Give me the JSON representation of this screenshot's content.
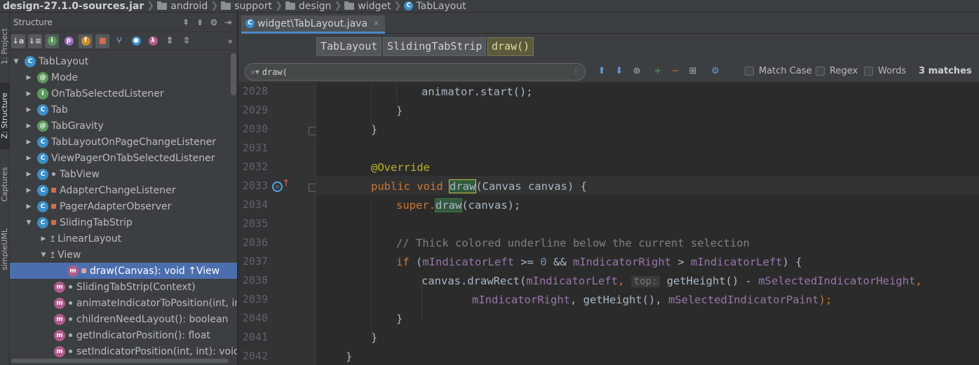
{
  "breadcrumb": [
    "design-27.1.0-sources.jar",
    "android",
    "support",
    "design",
    "widget",
    "TabLayout"
  ],
  "tool_stripe": {
    "project": "1: Project",
    "structure": "Z: Structure",
    "captures": "Captures",
    "simpleuml": "simpleUML"
  },
  "structure": {
    "title": "Structure",
    "items": [
      {
        "label": "TabLayout",
        "kind": "class",
        "expanded": true
      },
      {
        "label": "Mode",
        "kind": "interface"
      },
      {
        "label": "OnTabSelectedListener",
        "kind": "interface"
      },
      {
        "label": "Tab",
        "kind": "class"
      },
      {
        "label": "TabGravity",
        "kind": "interface"
      },
      {
        "label": "TabLayoutOnPageChangeListener",
        "kind": "class"
      },
      {
        "label": "ViewPagerOnTabSelectedListener",
        "kind": "class"
      },
      {
        "label": "TabView",
        "kind": "class"
      },
      {
        "label": "AdapterChangeListener",
        "kind": "class"
      },
      {
        "label": "PagerAdapterObserver",
        "kind": "class"
      },
      {
        "label": "SlidingTabStrip",
        "kind": "class",
        "expanded": true
      },
      {
        "label": "LinearLayout",
        "kind": "super"
      },
      {
        "label": "View",
        "kind": "super",
        "expanded": true
      },
      {
        "label": "draw(Canvas): void ↑View",
        "kind": "method",
        "selected": true
      },
      {
        "label": "SlidingTabStrip(Context)",
        "kind": "method"
      },
      {
        "label": "animateIndicatorToPosition(int, in",
        "kind": "method"
      },
      {
        "label": "childrenNeedLayout(): boolean",
        "kind": "method"
      },
      {
        "label": "getIndicatorPosition(): float",
        "kind": "method"
      },
      {
        "label": "setIndicatorPosition(int, int): void",
        "kind": "method"
      }
    ]
  },
  "editor": {
    "tab_label": "widget\\TabLayout.java",
    "chips": [
      "TabLayout",
      "SlidingTabStrip",
      "draw()"
    ],
    "find": {
      "query": "draw(",
      "match_case": "Match Case",
      "regex": "Regex",
      "words": "Words",
      "matches": "3 matches"
    },
    "line_numbers": [
      "2028",
      "2029",
      "2030",
      "2031",
      "2032",
      "2033",
      "2034",
      "2035",
      "2036",
      "2037",
      "2038",
      "2039",
      "2040",
      "2041",
      "2042"
    ],
    "code": {
      "l2028": "animator.start();",
      "l2029": "}",
      "l2030": "}",
      "l2032": "@Override",
      "l2033_kw": "public void ",
      "l2033_name": "draw",
      "l2033_rest": "(Canvas canvas) {",
      "l2034_super": "super.",
      "l2034_call": "draw",
      "l2034_rest": "(canvas);",
      "l2036": "// Thick colored underline below the current selection",
      "l2037_if": "if ",
      "l2037_a": "(",
      "l2037_f1": "mIndicatorLeft",
      "l2037_b": " >= ",
      "l2037_n": "0",
      "l2037_c": " && ",
      "l2037_f2": "mIndicatorRight",
      "l2037_d": " > ",
      "l2037_f3": "mIndicatorLeft",
      "l2037_e": ") {",
      "l2038_a": "canvas.drawRect(",
      "l2038_f1": "mIndicatorLeft",
      "l2038_b": ", ",
      "l2038_hint": "top:",
      "l2038_c": " getHeight() - ",
      "l2038_f2": "mSelectedIndicatorHeight",
      "l2038_d": ",",
      "l2039_f1": "mIndicatorRight",
      "l2039_a": ", getHeight(), ",
      "l2039_f2": "mSelectedIndicatorPaint",
      "l2039_b": ");",
      "l2040": "}",
      "l2041": "}",
      "l2042": "}"
    }
  }
}
